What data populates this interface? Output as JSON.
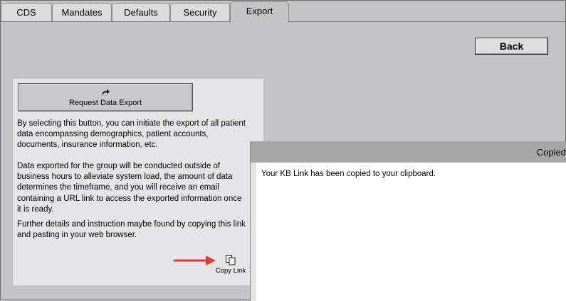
{
  "tabs": [
    {
      "label": "CDS",
      "active": false
    },
    {
      "label": "Mandates",
      "active": false
    },
    {
      "label": "Defaults",
      "active": false
    },
    {
      "label": "Security",
      "active": false
    },
    {
      "label": "Export",
      "active": true
    }
  ],
  "back_button": {
    "label": "Back"
  },
  "export_panel": {
    "request_button": {
      "label": "Request Data Export",
      "icon": "share-arrow-icon"
    },
    "paragraph1": [
      "By selecting this button, you can initiate the export of all patient",
      "data encompassing demographics, patient accounts,",
      "documents, insurance information, etc."
    ],
    "paragraph2": [
      "Data exported for the group will be conducted outside of",
      "business hours to alleviate system load, the amount of data",
      "determines the timeframe, and you will receive an email",
      "containing a URL link to access the exported information once",
      "it is ready."
    ],
    "paragraph3": [
      "Further details and instruction maybe found by copying this link",
      "and pasting in your web browser."
    ],
    "copy_link": {
      "label": "Copy Link",
      "icon": "copy-icon"
    }
  },
  "annotation": {
    "icon": "red-arrow-icon",
    "color": "#e53935"
  },
  "dialog": {
    "title": "Copied",
    "message": "Your KB Link has been copied to your clipboard."
  }
}
